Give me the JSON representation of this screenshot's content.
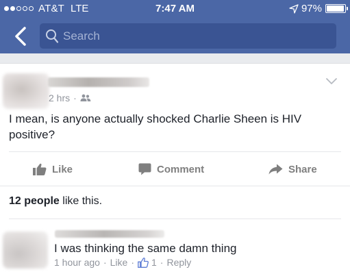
{
  "status_bar": {
    "carrier": "AT&T",
    "network": "LTE",
    "time": "7:47 AM",
    "battery": "97%",
    "battery_level": 0.97,
    "signal_bars_filled": 2,
    "signal_bars_total": 5
  },
  "nav": {
    "back_icon": "chevron-left-icon",
    "search_placeholder": "Search",
    "search_value": ""
  },
  "post": {
    "time": "2 hrs",
    "audience_icon": "friends-icon",
    "text": "I mean, is anyone actually shocked Charlie Sheen is HIV positive?",
    "actions": {
      "like": "Like",
      "comment": "Comment",
      "share": "Share"
    },
    "likes_count": "12 people",
    "likes_suffix": " like this."
  },
  "comment": {
    "text": "I was thinking the same damn thing",
    "time": "1 hour ago",
    "like": "Like",
    "like_count": "1",
    "reply": "Reply"
  },
  "colors": {
    "brand": "#4b67a6",
    "search_bg": "#3a5493",
    "text": "#1d2129",
    "muted": "#90949c"
  }
}
